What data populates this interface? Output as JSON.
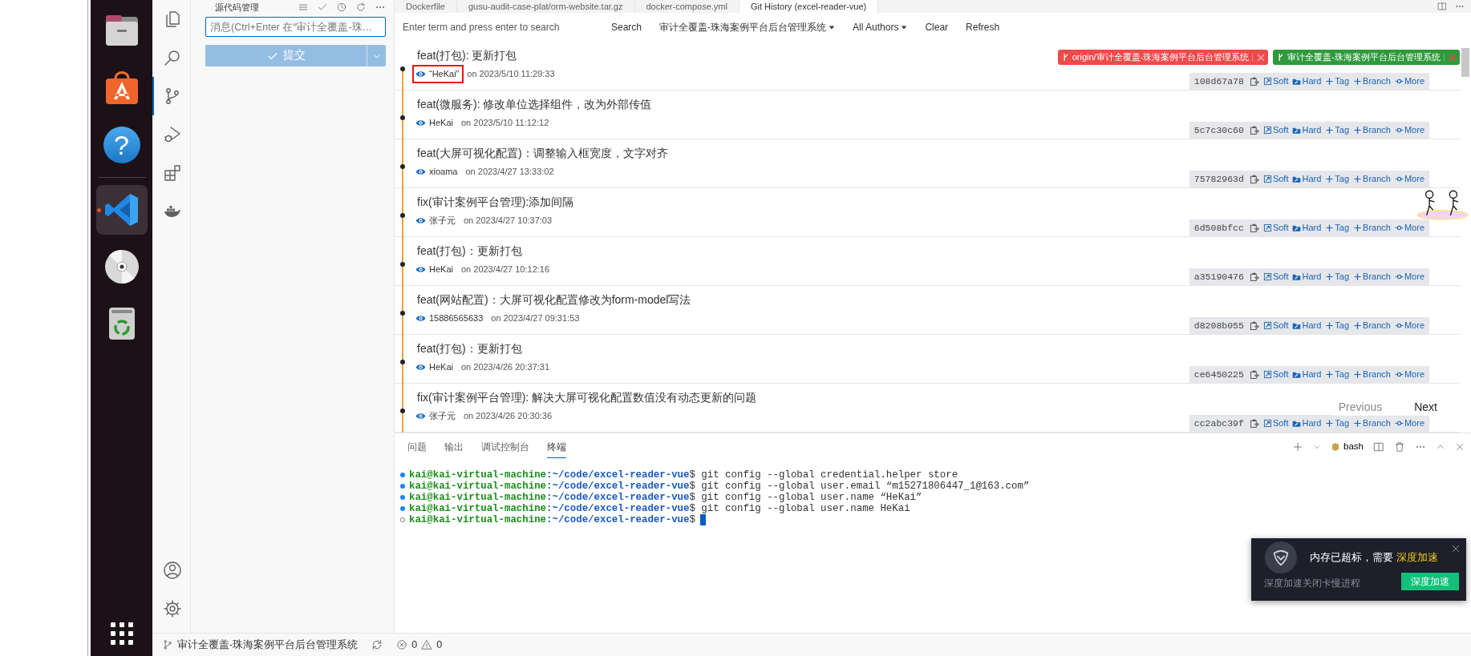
{
  "dock": [
    {
      "kind": "files",
      "selected": false
    },
    {
      "kind": "store",
      "selected": false
    },
    {
      "kind": "help",
      "selected": false,
      "glyph": "?"
    },
    {
      "kind": "vscode",
      "selected": true
    },
    {
      "kind": "disc",
      "selected": false
    },
    {
      "kind": "trash",
      "selected": false
    }
  ],
  "dock_apps_button": {
    "kind": "grid"
  },
  "activity_bar": {
    "items": [
      {
        "kind": "explorer",
        "selected": false
      },
      {
        "kind": "search",
        "selected": false
      },
      {
        "kind": "source-control",
        "selected": true
      },
      {
        "kind": "run-debug",
        "selected": false
      },
      {
        "kind": "extensions",
        "selected": false
      },
      {
        "kind": "docker",
        "selected": false
      }
    ],
    "bottom": [
      {
        "kind": "account",
        "selected": false
      },
      {
        "kind": "settings",
        "selected": false
      }
    ]
  },
  "sidebar": {
    "title": "源代码管理",
    "message_input": {
      "placeholder": "消息(Ctrl+Enter 在“审计全覆盖-珠…"
    },
    "commit_button": {
      "label": "提交",
      "disabled": true
    }
  },
  "editor_tabs": [
    {
      "label": "Dockerfile",
      "selected": false
    },
    {
      "label": "gusu-audit-case-plat/orm-website.tar.gz",
      "selected": false
    },
    {
      "label": "docker-compose.yml",
      "selected": false
    },
    {
      "label": "Git History (excel-reader-vue)",
      "selected": true
    }
  ],
  "git_history": {
    "search": {
      "placeholder": "Enter term and press enter to search"
    },
    "toolbar": [
      {
        "kind": "button",
        "label": "Search"
      },
      {
        "kind": "dropdown",
        "label": "审计全覆盖-珠海案例平台后台管理系统"
      },
      {
        "kind": "dropdown",
        "label": "All Authors"
      },
      {
        "kind": "button",
        "label": "Clear"
      },
      {
        "kind": "button",
        "label": "Refresh"
      }
    ],
    "commits": [
      {
        "title": "feat(打包): 更新打包",
        "author": "“HeKai”",
        "date": "on 2023/5/10 11:29:33",
        "hash": "108d67a78",
        "highlighted": true,
        "actions": [
          "Soft",
          "Hard",
          "Tag",
          "Branch",
          "More"
        ],
        "refs": [
          {
            "kind": "remote",
            "label": "origin/审计全覆盖-珠海案例平台后台管理系统",
            "color": "#ef4a4a"
          },
          {
            "kind": "local",
            "label": "审计全覆盖-珠海案例平台后台管理系统",
            "color": "#2f9a3c"
          }
        ]
      },
      {
        "title": "feat(微服务): 修改单位选择组件，改为外部传值",
        "author": "HeKai",
        "date": "on 2023/5/10 11:12:12",
        "hash": "5c7c30c60",
        "highlighted": false,
        "actions": [
          "Soft",
          "Hard",
          "Tag",
          "Branch",
          "More"
        ]
      },
      {
        "title": "feat(大屏可视化配置)：调整输入框宽度，文字对齐",
        "author": "xioama",
        "date": "on 2023/4/27 13:33:02",
        "hash": "75782963d",
        "highlighted": false,
        "actions": [
          "Soft",
          "Hard",
          "Tag",
          "Branch",
          "More"
        ]
      },
      {
        "title": "fix(审计案例平台管理):添加间隔",
        "author": "张子元",
        "date": "on 2023/4/27 10:37:03",
        "hash": "6d508bfcc",
        "highlighted": false,
        "actions": [
          "Soft",
          "Hard",
          "Tag",
          "Branch",
          "More"
        ]
      },
      {
        "title": "feat(打包)：更新打包",
        "author": "HeKai",
        "date": "on 2023/4/27 10:12:16",
        "hash": "a35190476",
        "highlighted": false,
        "actions": [
          "Soft",
          "Hard",
          "Tag",
          "Branch",
          "More"
        ]
      },
      {
        "title": "feat(网站配置)：大屏可视化配置修改为form-model写法",
        "author": "15886565633",
        "date": "on 2023/4/27 09:31:53",
        "hash": "d8208b055",
        "highlighted": false,
        "actions": [
          "Soft",
          "Hard",
          "Tag",
          "Branch",
          "More"
        ]
      },
      {
        "title": "feat(打包)：更新打包",
        "author": "HeKai",
        "date": "on 2023/4/26 20:37:31",
        "hash": "ce6450225",
        "highlighted": false,
        "actions": [
          "Soft",
          "Hard",
          "Tag",
          "Branch",
          "More"
        ]
      },
      {
        "title": "fix(审计案例平台管理): 解决大屏可视化配置数值没有动态更新的问题",
        "author": "张子元",
        "date": "on 2023/4/26 20:30:36",
        "hash": "cc2abc39f",
        "highlighted": false,
        "actions": [
          "Soft",
          "Hard",
          "Tag",
          "Branch",
          "More"
        ]
      }
    ],
    "pager": {
      "previous": {
        "label": "Previous",
        "disabled": true
      },
      "next": {
        "label": "Next",
        "disabled": false
      }
    }
  },
  "panel": {
    "tabs": [
      {
        "label": "问题",
        "selected": false
      },
      {
        "label": "输出",
        "selected": false
      },
      {
        "label": "调试控制台",
        "selected": false
      },
      {
        "label": "终端",
        "selected": true
      }
    ],
    "shell": "bash",
    "terminal": [
      {
        "kind": "done",
        "user": "kai@kai-virtual-machine",
        "path": ":~/code/excel-reader-vue",
        "command": "$ git config --global credential.helper store"
      },
      {
        "kind": "done",
        "user": "kai@kai-virtual-machine",
        "path": ":~/code/excel-reader-vue",
        "command": "$ git config --global user.email “m15271806447_1@163.com”"
      },
      {
        "kind": "done",
        "user": "kai@kai-virtual-machine",
        "path": ":~/code/excel-reader-vue",
        "command": "$ git config --global user.name “HeKai”"
      },
      {
        "kind": "done",
        "user": "kai@kai-virtual-machine",
        "path": ":~/code/excel-reader-vue",
        "command": "$ git config --global user.name HeKai"
      },
      {
        "kind": "current",
        "user": "kai@kai-virtual-machine",
        "path": ":~/code/excel-reader-vue",
        "command": "$"
      }
    ]
  },
  "notification": {
    "message": "内存已超标，需要",
    "highlight": "深度加速",
    "description": "深度加速关闭卡慢进程",
    "button": "深度加速"
  },
  "status_bar": {
    "branch": "审计全覆盖-珠海案例平台后台管理系统",
    "errors": "0",
    "warnings": "0"
  }
}
